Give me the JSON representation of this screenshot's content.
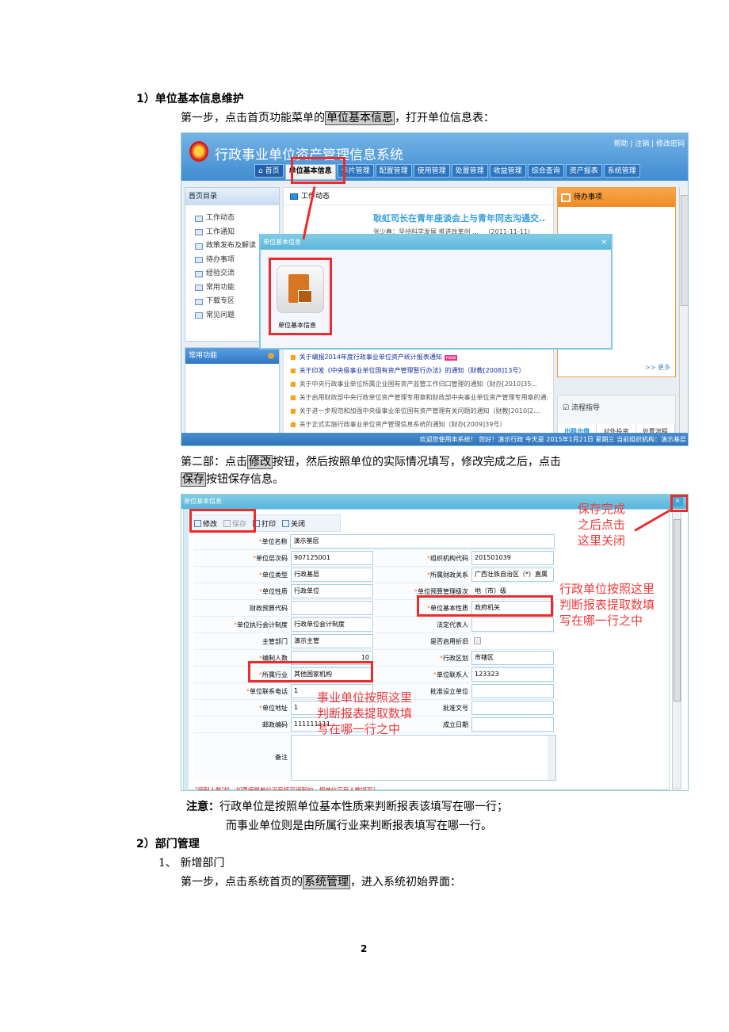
{
  "doc": {
    "section1_title": "1）单位基本信息维护",
    "step1_prefix": "第一步，点击首页功能菜单的",
    "step1_highlight": "单位基本信息",
    "step1_suffix": "，打开单位信息表：",
    "step2_prefix": "第二部：点击",
    "step2_highlight1": "修改",
    "step2_mid": "按钮，然后按照单位的实际情况填写，修改完成之后，点击",
    "step2_highlight2": "保存",
    "step2_suffix": "按钮保存信息。",
    "note_label": "注意：",
    "note_line1": "行政单位是按照单位基本性质来判断报表该填写在哪一行；",
    "note_line2": "而事业单位则是由所属行业来判断报表填写在哪一行。",
    "section2_title": "2）部门管理",
    "sub1_title": "1、 新增部门",
    "step3_prefix": "第一步，点击系统首页的",
    "step3_highlight": "系统管理",
    "step3_suffix": "，进入系统初始界面：",
    "page_number": "2"
  },
  "shot1": {
    "app_title": "行政事业单位资产管理信息系统",
    "top_links": "帮助 | 注销 | 修改密码",
    "nav_tabs": [
      "首页",
      "单位基本信息",
      "卡片管理",
      "配置管理",
      "使用管理",
      "处置管理",
      "收益管理",
      "综合查询",
      "资产报表",
      "系统管理"
    ],
    "left_header": "首页目录",
    "left_items": [
      "工作动态",
      "工作通知",
      "政策发布及解读",
      "待办事项",
      "经验交流",
      "常用功能",
      "下载专区",
      "常见问题"
    ],
    "left2_header": "常用功能",
    "mid_header": "工作动态",
    "headline": "耿虹司长在青年座谈会上与青年同志沟通交..",
    "subline": "张少春：坚持科学发展 推进改革创 ...",
    "subline_date": "(2011-11-11)",
    "news": [
      {
        "text": "关于编报2014年度行政事业单位资产统计报表通知",
        "style": "blue",
        "badge": "new"
      },
      {
        "text": "关于印发《中央级事业单位国有资产管理暂行办法》的通知（财教[2008]13号）",
        "style": "blue"
      },
      {
        "text": "关于中央行政事业单位所属企业国有资产监管工作归口管理的通知（财办[2010]35...",
        "style": "gray"
      },
      {
        "text": "关于启用财政部中央行政单位资产管理专用章和财政部中央事业单位资产管理专用章的通:",
        "style": "gray"
      },
      {
        "text": "关于进一步规范和加强中央级事业单位国有资产管理有关问题的通知（财教[2010]2...",
        "style": "gray"
      },
      {
        "text": "关于正式实施行政事业单位资产管理信息系统的通知（财办[2009]39号）",
        "style": "gray"
      }
    ],
    "todo_header": "待办事项",
    "more_link": ">> 更多",
    "flow_header": "流程指导",
    "flow_tabs": [
      "出租出借",
      "对外投资",
      "处置流程"
    ],
    "status_bar": "欢迎您使用本系统！ 您好！演示行政 今天是 2015年1月21日 星期三 当前组织机构：演示基层",
    "dialog_title": "单位基本信息",
    "dialog_close": "×",
    "dialog_app_label": "单位基本信息"
  },
  "shot2": {
    "window_title": "单位基本信息",
    "close": "×",
    "toolbar": {
      "edit": "修改",
      "save": "保存",
      "print": "打印",
      "close": "关闭"
    },
    "fields": {
      "unit_name": {
        "label": "单位名称",
        "value": "演示基层"
      },
      "unit_code": {
        "label": "单位层次码",
        "value": "907125001"
      },
      "org_code": {
        "label": "组织机构代码",
        "value": "201501039"
      },
      "unit_type": {
        "label": "单位类型",
        "value": "行政基层"
      },
      "finance_rel": {
        "label": "所属财政关系",
        "value": "广西壮族自治区（*）直属"
      },
      "unit_nature": {
        "label": "单位性质",
        "value": "行政单位"
      },
      "budget_level": {
        "label": "单位预算管理级次",
        "value": "地（市）级"
      },
      "budget_code": {
        "label": "财政预算代码",
        "value": ""
      },
      "basic_nature": {
        "label": "单位基本性质",
        "value": "政府机关"
      },
      "accounting": {
        "label": "单位执行会计制度",
        "value": "行政单位会计制度"
      },
      "legal_rep": {
        "label": "法定代表人",
        "value": ""
      },
      "supervisor": {
        "label": "主管部门",
        "value": "演示主管"
      },
      "depreciation": {
        "label": "是否启用折旧",
        "value": "checked"
      },
      "staff_count": {
        "label": "编制人数",
        "value": "10"
      },
      "region": {
        "label": "行政区划",
        "value": "市辖区"
      },
      "industry": {
        "label": "所属行业",
        "value": "其他国家机构"
      },
      "contact": {
        "label": "单位联系人",
        "value": "123323"
      },
      "phone": {
        "label": "单位联系电话",
        "value": "1"
      },
      "approver": {
        "label": "批准设立单位",
        "value": ""
      },
      "address": {
        "label": "单位地址",
        "value": "1"
      },
      "approval_no": {
        "label": "批准文号",
        "value": ""
      },
      "postcode": {
        "label": "邮政编码",
        "value": "111111111"
      },
      "founded": {
        "label": "成立日期",
        "value": ""
      },
      "remarks": {
        "label": "备注",
        "value": ""
      }
    },
    "footnote": "\"编制人数\"栏，如果编报单位没有核定编制的，按单位实有人数填写！",
    "annot_close": "保存完成之后点击这里关闭",
    "annot_close_lines": [
      "保存完成",
      "之后点击",
      "这里关闭"
    ],
    "annot_admin_lines": [
      "行政单位按照这里",
      "判断报表提取数填",
      "写在哪一行之中"
    ],
    "annot_public_lines": [
      "事业单位按照这里",
      "判断报表提取数填",
      "写在哪一行之中"
    ]
  }
}
